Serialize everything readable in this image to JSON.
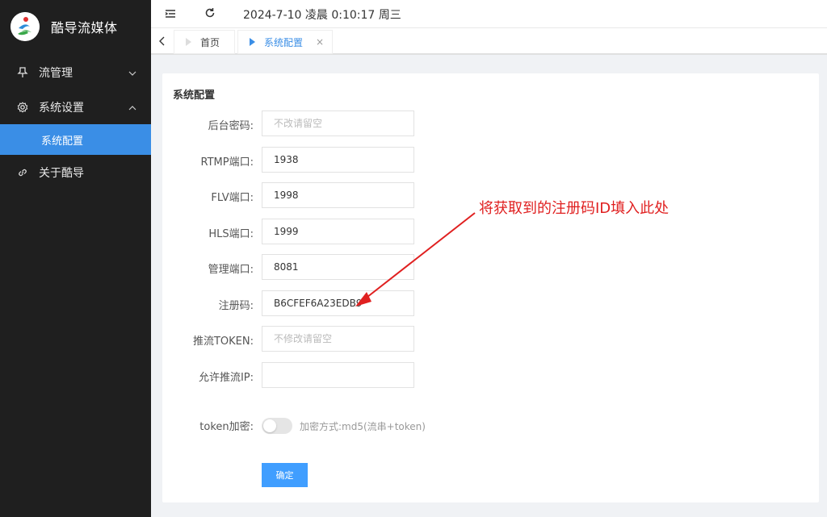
{
  "app": {
    "title": "酷导流媒体"
  },
  "sidebar": {
    "items": [
      {
        "label": "流管理",
        "icon": "pin-icon",
        "chevron": "down"
      },
      {
        "label": "系统设置",
        "icon": "gear-icon",
        "chevron": "up"
      },
      {
        "label": "系统配置",
        "active": true
      },
      {
        "label": "关于酷导",
        "icon": "link-icon"
      }
    ]
  },
  "header": {
    "datetime": "2024-7-10 凌晨 0:10:17 周三"
  },
  "tabs": [
    {
      "label": "首页",
      "active": false
    },
    {
      "label": "系统配置",
      "active": true,
      "close": "×"
    }
  ],
  "form": {
    "title": "系统配置",
    "fields": [
      {
        "label": "后台密码:",
        "value": "",
        "placeholder": "不改请留空"
      },
      {
        "label": "RTMP端口:",
        "value": "1938"
      },
      {
        "label": "FLV端口:",
        "value": "1998"
      },
      {
        "label": "HLS端口:",
        "value": "1999"
      },
      {
        "label": "管理端口:",
        "value": "8081"
      },
      {
        "label": "注册码:",
        "value": "B6CFEF6A23EDB9"
      },
      {
        "label": "推流TOKEN:",
        "value": "",
        "placeholder": "不修改请留空"
      },
      {
        "label": "允许推流IP:",
        "value": ""
      }
    ],
    "toggle": {
      "label": "token加密:",
      "hint": "加密方式:md5(流串+token)",
      "on": false
    },
    "submit_label": "确定"
  },
  "annotation": {
    "text": "将获取到的注册码ID填入此处"
  },
  "colors": {
    "accent": "#409eff",
    "sidebar_bg": "#1f1f1f",
    "annotation": "#e02020"
  }
}
